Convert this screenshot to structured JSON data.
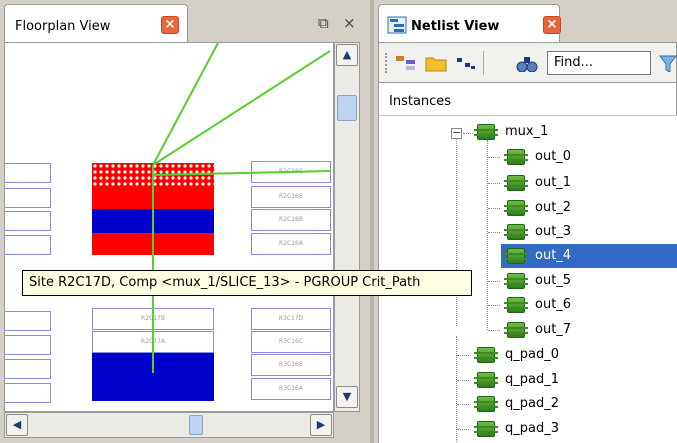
{
  "floorplan": {
    "tab_label": "Floorplan View",
    "tab_close": "×",
    "restore_glyph": "⧉",
    "close_glyph": "×",
    "cell_labels": [
      "R2C16C",
      "R2C16B",
      "R2C16A",
      "R2C17B",
      "R2C17A",
      "R3C17D",
      "R3C16C",
      "R3C16B",
      "R3C16A"
    ],
    "tooltip": "Site R2C17D, Comp <mux_1/SLICE_13> - PGROUP Crit_Path",
    "colors": {
      "route": "#55d02a",
      "pgroup_red": "#ff0000",
      "pgroup_blue": "#0000cc",
      "cell_border": "#8a8ae0"
    }
  },
  "netlist": {
    "tab_label": "Netlist View",
    "tab_close": "×",
    "find_placeholder": "Find...",
    "section_header": "Instances",
    "tree": {
      "parent": {
        "label": "mux_1",
        "expander": "−"
      },
      "children": [
        "out_0",
        "out_1",
        "out_2",
        "out_3",
        "out_4",
        "out_5",
        "out_6",
        "out_7"
      ],
      "selected_child_index": 4,
      "siblings": [
        "q_pad_0",
        "q_pad_1",
        "q_pad_2",
        "q_pad_3"
      ]
    },
    "colors": {
      "selection": "#316ac5",
      "chip_icon": "#4a9a2a"
    }
  }
}
